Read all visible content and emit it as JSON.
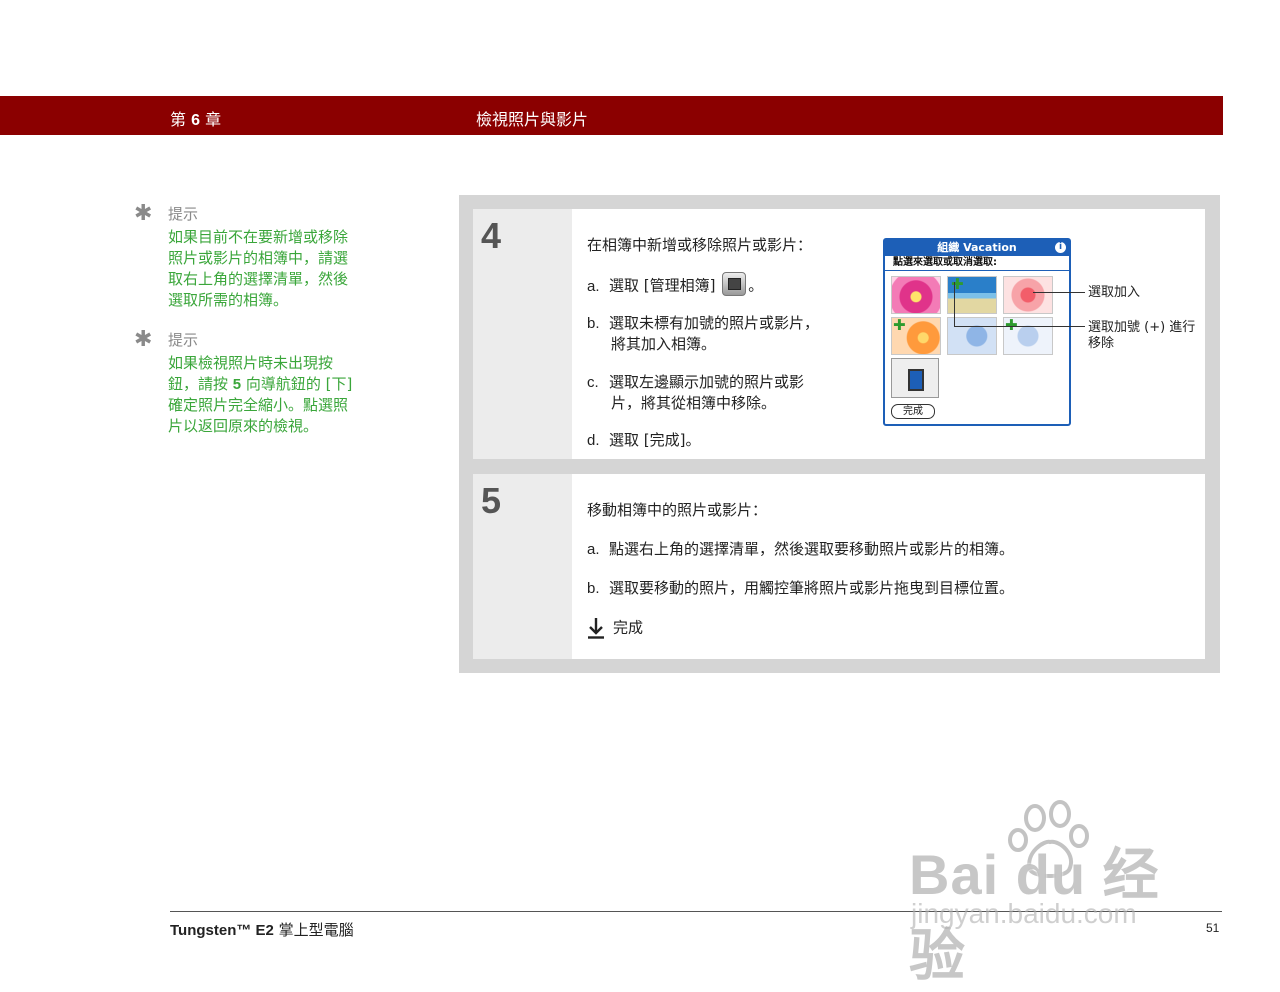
{
  "header": {
    "chapter_prefix": "第",
    "chapter_number": "6",
    "chapter_suffix": "章",
    "title": "檢視照片與影片",
    "color": "#8b0000"
  },
  "tips": [
    {
      "label": "提示",
      "lines": [
        "如果目前不在要新增或移除",
        "照片或影片的相簿中，請選",
        "取右上角的選擇清單，然後",
        "選取所需的相簿。"
      ]
    },
    {
      "label": "提示",
      "line1": "如果檢視照片時未出現按",
      "line2_pre": "鈕，請按 ",
      "line2_num": "5",
      "line2_post": " 向導航鈕的 [下]",
      "line3": "確定照片完全縮小。點選照",
      "line4": "片以返回原來的檢視。"
    }
  ],
  "step4": {
    "number": "4",
    "intro": "在相簿中新增或移除照片或影片：",
    "a_label": "a.",
    "a_text": "選取 [管理相簿]",
    "a_after": "。",
    "b_label": "b.",
    "b_line1": "選取未標有加號的照片或影片，",
    "b_line2": "將其加入相簿。",
    "c_label": "c.",
    "c_line1": "選取左邊顯示加號的照片或影",
    "c_line2": "片，將其從相簿中移除。",
    "d_label": "d.",
    "d_text": "選取 [完成]。",
    "screenshot": {
      "title": "組織 Vacation",
      "subtitle": "點選來選取或取消選取:",
      "done_button": "完成",
      "info_icon": "i"
    },
    "callout_add": "選取加入",
    "callout_remove_line1": "選取加號 (+) 進行",
    "callout_remove_line2": "移除"
  },
  "step5": {
    "number": "5",
    "intro": "移動相簿中的照片或影片：",
    "a_label": "a.",
    "a_text": "點選右上角的選擇清單，然後選取要移動照片或影片的相簿。",
    "b_label": "b.",
    "b_text": "選取要移動的照片，用觸控筆將照片或影片拖曳到目標位置。",
    "done_icon": "download-arrow-icon",
    "done_text": "完成"
  },
  "footer": {
    "product_bold": "Tungsten™ E2",
    "product_rest": " 掌上型電腦",
    "page_number": "51"
  },
  "watermark": {
    "logo": "Bai du 经验",
    "url": "jingyan.baidu.com"
  },
  "colors": {
    "tip_text": "#3aa63a",
    "palm_blue": "#1d5fb7",
    "frame_gray": "#d5d5d5"
  }
}
